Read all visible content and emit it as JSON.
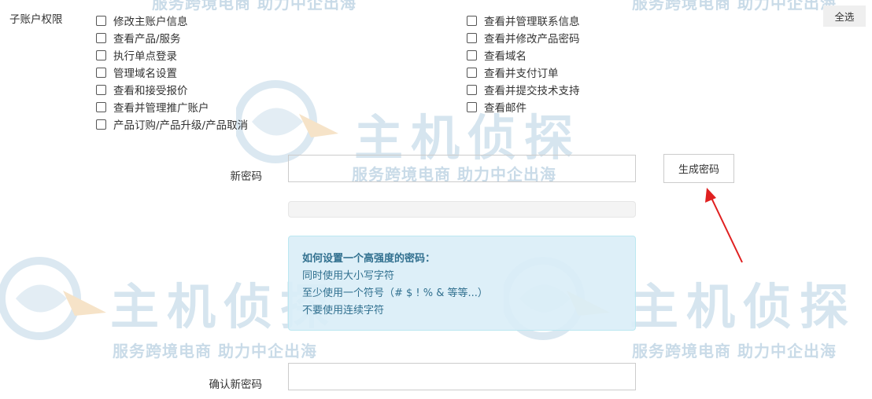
{
  "permissions": {
    "section_label": "子账户权限",
    "select_all_label": "全选",
    "left_items": [
      "修改主账户信息",
      "查看产品/服务",
      "执行单点登录",
      "管理域名设置",
      "查看和接受报价",
      "查看并管理推广账户",
      "产品订购/产品升级/产品取消"
    ],
    "right_items": [
      "查看并管理联系信息",
      "查看并修改产品密码",
      "查看域名",
      "查看并支付订单",
      "查看并提交技术支持",
      "查看邮件"
    ]
  },
  "password": {
    "new_label": "新密码",
    "new_value": "",
    "generate_label": "生成密码",
    "strength": 0,
    "tips": {
      "title": "如何设置一个高强度的密码：",
      "lines": [
        "同时使用大小写字符",
        "至少使用一个符号（# $ ! % & 等等...）",
        "不要使用连续字符"
      ]
    },
    "confirm_label": "确认新密码",
    "confirm_value": ""
  },
  "watermark": {
    "logo_text": "主机侦探",
    "slogan": "服务跨境电商 助力中企出海"
  },
  "colors": {
    "annotation_arrow": "#e02020",
    "tips_text": "#31708f",
    "tips_background": "#d9edf7",
    "watermark": "#c9dbe8"
  },
  "icons": [
    "checkbox-icon",
    "annotation-arrow-icon",
    "watermark-logo-icon"
  ]
}
